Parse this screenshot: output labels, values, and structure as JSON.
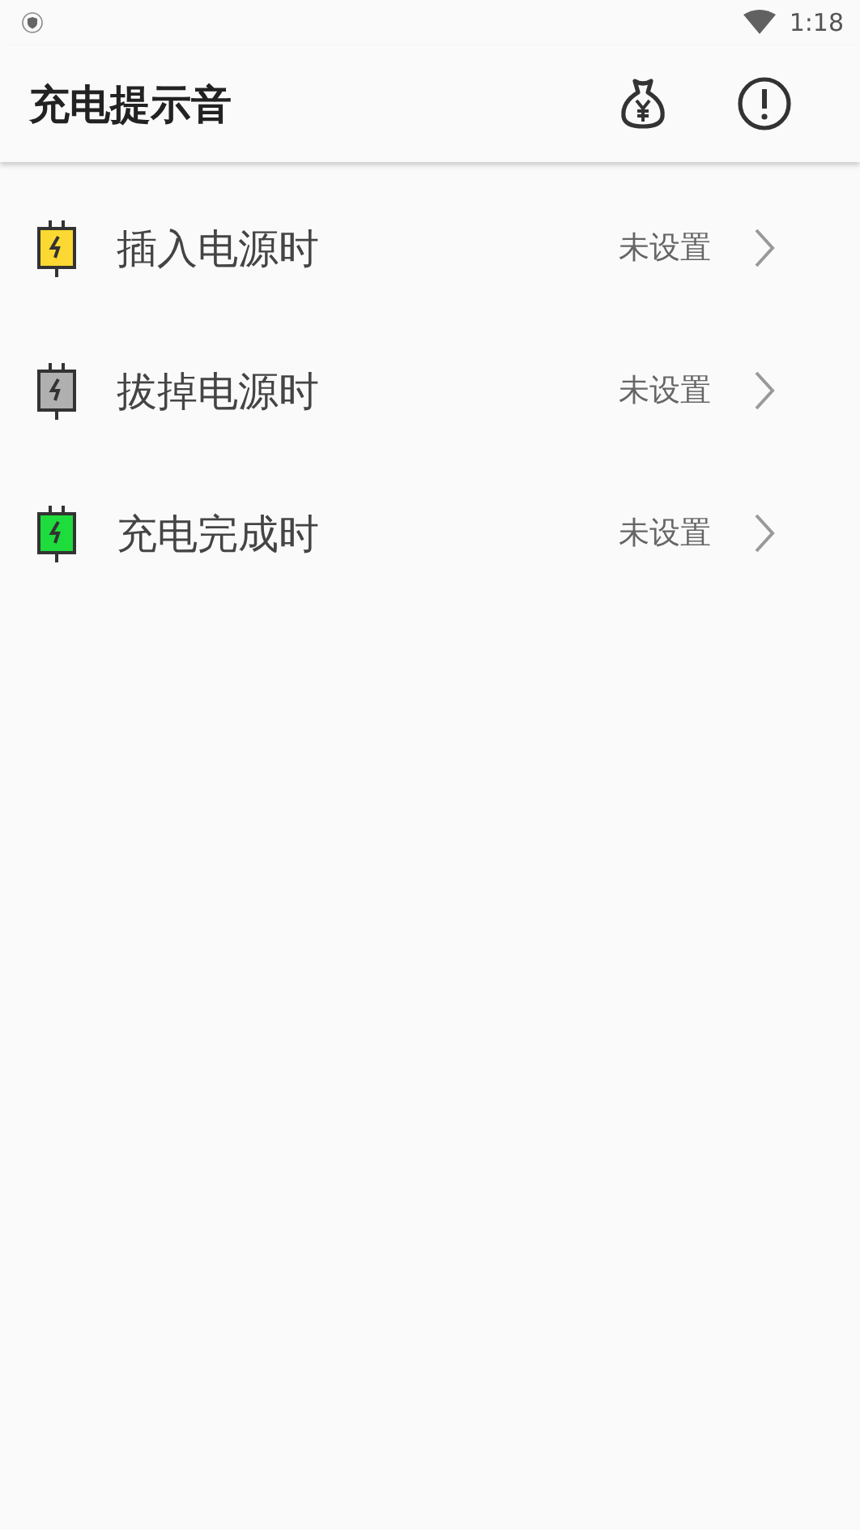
{
  "status_bar": {
    "time": "1:18"
  },
  "app_bar": {
    "title": "充电提示音"
  },
  "items": [
    {
      "label": "插入电源时",
      "value": "未设置",
      "color": "#fcd832"
    },
    {
      "label": "拔掉电源时",
      "value": "未设置",
      "color": "#b0b0b0"
    },
    {
      "label": "充电完成时",
      "value": "未设置",
      "color": "#1edc3c"
    }
  ]
}
